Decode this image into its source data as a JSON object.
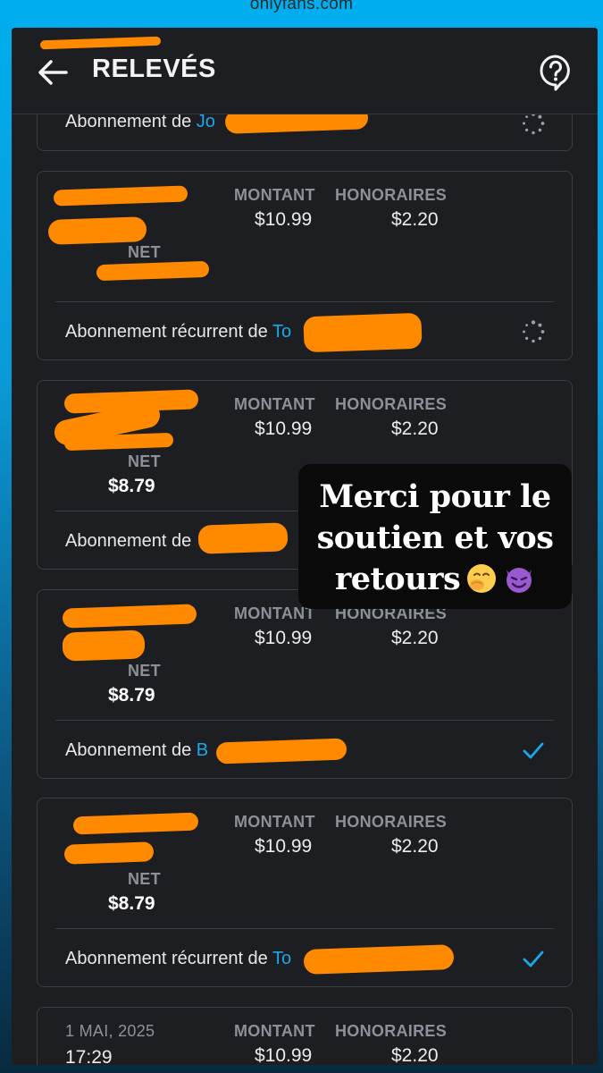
{
  "browser": {
    "url": "onlyfans.com"
  },
  "header": {
    "title": "RELEVÉS"
  },
  "columns": {
    "amount": "MONTANT",
    "fees": "HONORAIRES",
    "net": "NET"
  },
  "top_partial": {
    "description_prefix": "Abonnement de",
    "description_link": "Jo"
  },
  "statements": [
    {
      "date": "",
      "time": "",
      "amount": "$10.99",
      "fees": "$2.20",
      "net": "",
      "description_prefix": "Abonnement récurrent de",
      "description_link": "To",
      "status": "pending"
    },
    {
      "date": "",
      "time": "",
      "amount": "$10.99",
      "fees": "$2.20",
      "net": "$8.79",
      "description_prefix": "Abonnement de",
      "description_link": "",
      "status": ""
    },
    {
      "date": "",
      "time": "",
      "amount": "$10.99",
      "fees": "$2.20",
      "net": "$8.79",
      "description_prefix": "Abonnement de",
      "description_link": "B",
      "status": "complete"
    },
    {
      "date": "",
      "time": "",
      "amount": "$10.99",
      "fees": "$2.20",
      "net": "$8.79",
      "description_prefix": "Abonnement récurrent de",
      "description_link": "To",
      "status": "complete"
    },
    {
      "date": "1 MAI, 2025",
      "time": "17:29",
      "amount": "$10.99",
      "fees": "$2.20",
      "net": "",
      "description_prefix": "",
      "description_link": "",
      "status": ""
    }
  ],
  "overlay": {
    "line1": "Merci pour le",
    "line2": "soutien et vos",
    "line3": "retours",
    "emojis": [
      "face-with-hand-over-mouth-emoji",
      "smiling-devil-emoji"
    ]
  },
  "colors": {
    "accent": "#1aa7ec",
    "redaction": "#ff8a00",
    "background": "#1d1e22"
  }
}
